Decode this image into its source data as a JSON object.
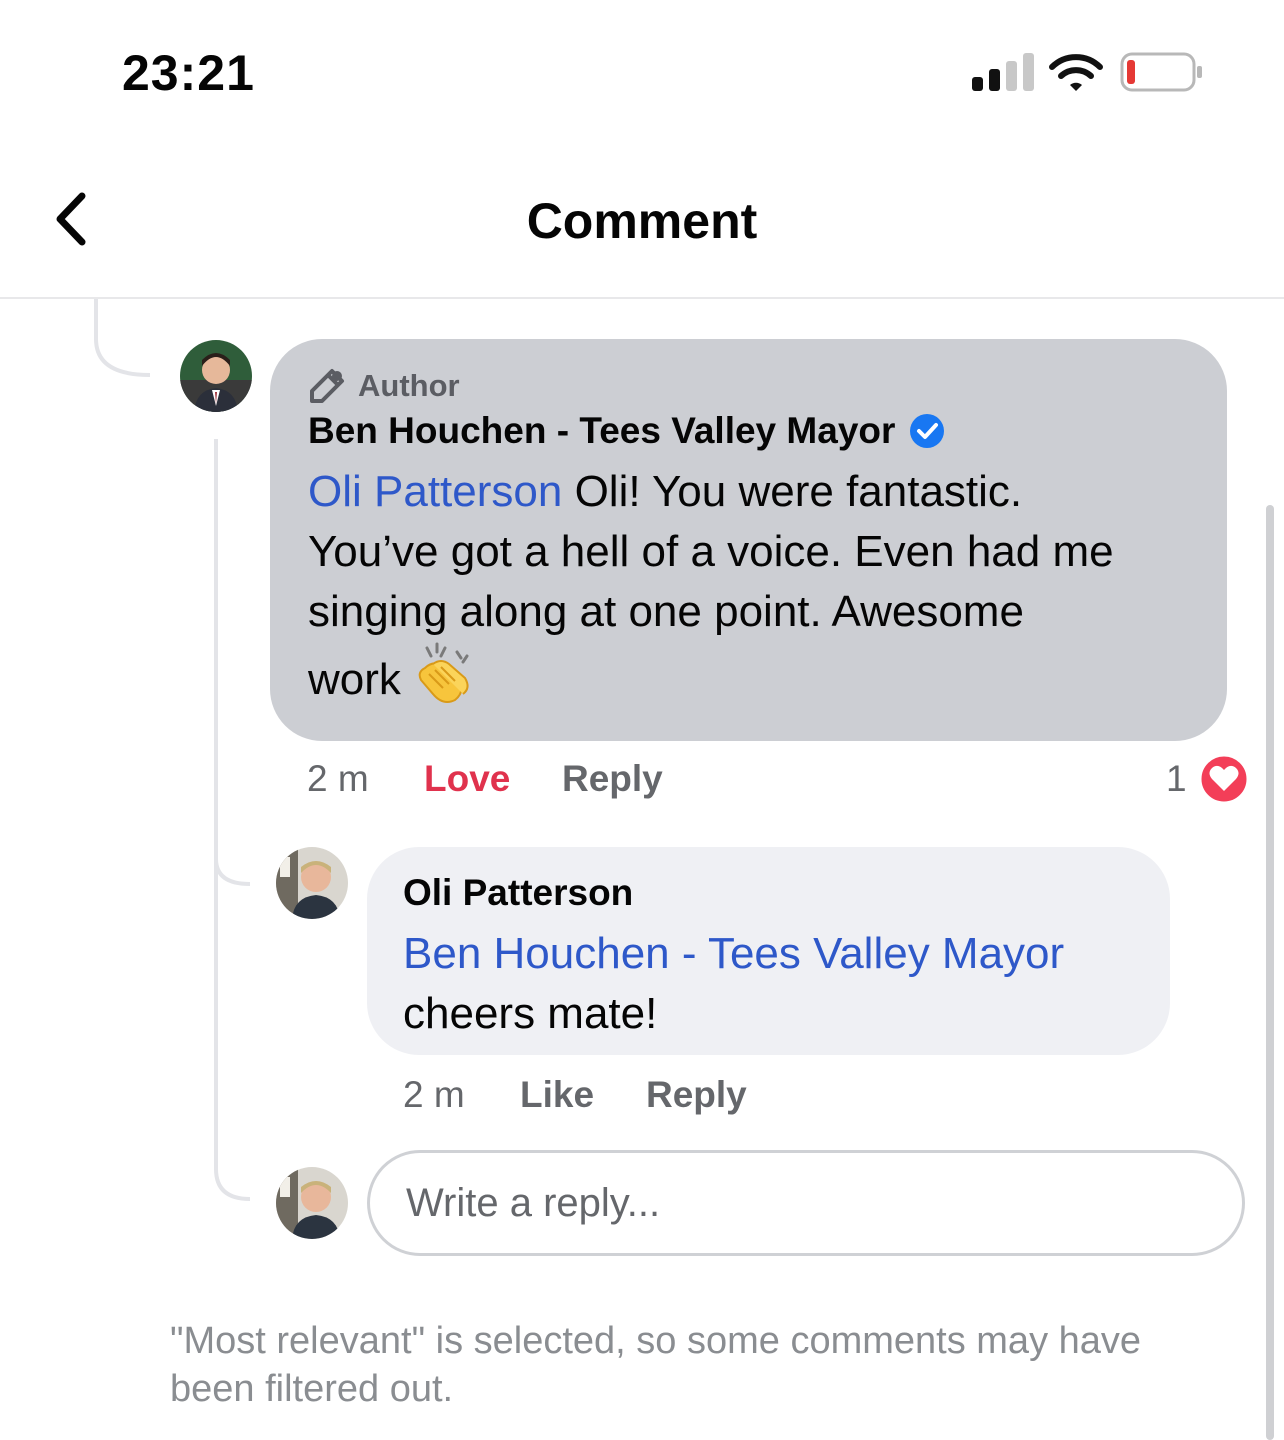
{
  "status_bar": {
    "time": "23:21",
    "battery_color": "#e53935"
  },
  "header": {
    "title": "Comment",
    "back_icon": "chevron-left-icon"
  },
  "comment": {
    "author_badge": "Author",
    "author_name": "Ben Houchen - Tees Valley Mayor",
    "verified": true,
    "mention": "Oli Patterson",
    "text_line1": " Oli! You were fantastic.",
    "text_line2": "You’ve got a hell of a voice. Even had me",
    "text_line3": "singing along at one point. Awesome",
    "text_line4": "work",
    "emoji": "clapping-hands-icon",
    "time": "2 m",
    "reaction_label": "Love",
    "reply_label": "Reply",
    "reaction_count": "1"
  },
  "reply": {
    "author_name": "Oli Patterson",
    "mention": "Ben Houchen - Tees Valley Mayor",
    "text": "cheers mate!",
    "time": "2 m",
    "like_label": "Like",
    "reply_label": "Reply"
  },
  "reply_input": {
    "placeholder": "Write a reply..."
  },
  "footer": {
    "note": "\"Most relevant\" is selected, so some comments may have been filtered out."
  },
  "colors": {
    "mention": "#2e58c9",
    "love": "#e0324d",
    "bubble_main": "#ccced3",
    "bubble_reply": "#eff0f4"
  }
}
